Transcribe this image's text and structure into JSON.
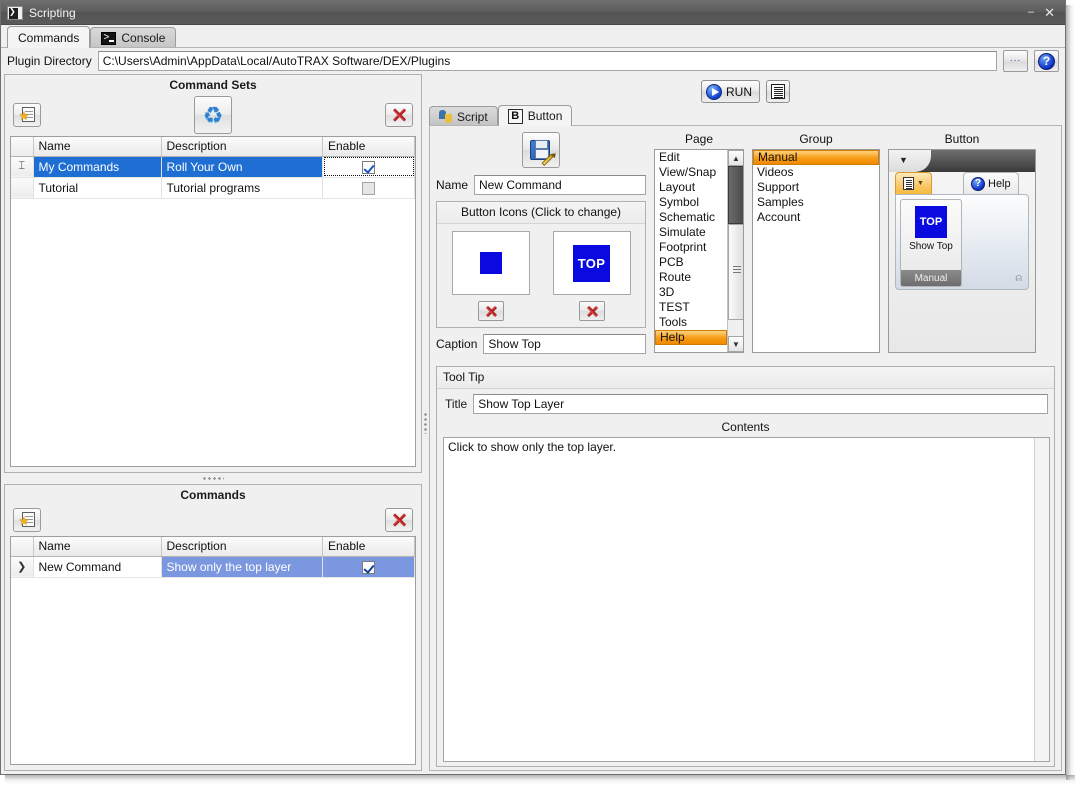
{
  "window": {
    "title": "Scripting",
    "icon": "console-icon",
    "minimize_label": "–",
    "close_label": "✕"
  },
  "top_tabs": [
    {
      "label": "Commands",
      "icon": "",
      "active": true
    },
    {
      "label": "Console",
      "icon": "console-icon",
      "active": false
    }
  ],
  "plugin_dir": {
    "label": "Plugin Directory",
    "value": "C:\\Users\\Admin\\AppData\\Local/AutoTRAX Software/DEX/Plugins",
    "browse_label": "...",
    "help_label": "?"
  },
  "command_sets": {
    "title": "Command Sets",
    "toolbar": {
      "new_label": "new-command-set",
      "refresh_label": "refresh",
      "delete_label": "delete"
    },
    "columns": [
      "",
      "Name",
      "Description",
      "Enable"
    ],
    "rows": [
      {
        "indicator": "⌶",
        "name": "My Commands",
        "description": "Roll Your Own",
        "enabled": true,
        "selected": true
      },
      {
        "indicator": "",
        "name": "Tutorial",
        "description": "Tutorial programs",
        "enabled": false,
        "selected": false
      }
    ]
  },
  "commands": {
    "title": "Commands",
    "toolbar": {
      "new_label": "new-command",
      "delete_label": "delete"
    },
    "columns": [
      "",
      "Name",
      "Description",
      "Enable"
    ],
    "rows": [
      {
        "indicator": "❯",
        "name": "New Command",
        "description": "Show only the top layer",
        "enabled": true,
        "selected": true
      }
    ]
  },
  "right": {
    "run_label": "RUN",
    "log_label": "log",
    "tabs": [
      {
        "label": "Script",
        "icon": "python-icon",
        "active": false
      },
      {
        "label": "Button",
        "icon": "bold-b-icon",
        "active": true
      }
    ],
    "save_label": "save",
    "name": {
      "label": "Name",
      "value": "New Command"
    },
    "button_icons": {
      "title": "Button Icons (Click to change)",
      "small_icon": "",
      "large_icon": "TOP",
      "delete_small_label": "delete-small-icon",
      "delete_large_label": "delete-large-icon"
    },
    "caption": {
      "label": "Caption",
      "value": "Show Top"
    },
    "page_list": {
      "caption": "Page",
      "items": [
        "Edit",
        "View/Snap",
        "Layout",
        "Symbol",
        "Schematic",
        "Simulate",
        "Footprint",
        "PCB",
        "Route",
        "3D",
        "TEST",
        "Tools",
        "Help"
      ],
      "selected": "Help"
    },
    "group_list": {
      "caption": "Group",
      "items": [
        "Manual",
        "Videos",
        "Support",
        "Samples",
        "Account"
      ],
      "selected": "Manual"
    },
    "button_preview": {
      "caption": "Button",
      "ribbon_tab_active": "",
      "ribbon_tab_other": "Help",
      "icon_text": "TOP",
      "button_caption": "Show Top",
      "group_name": "Manual"
    },
    "tooltip": {
      "group_title": "Tool Tip",
      "title_label": "Title",
      "title_value": "Show Top Layer",
      "contents_label": "Contents",
      "contents_value": "Click to show only the top layer."
    }
  },
  "colors": {
    "selection_blue": "#1f6ed4",
    "selection_light_blue": "#7a97e0",
    "selection_orange": "#f79c16",
    "icon_blue": "#0a0ae0",
    "window_bg": "#f0f0f0"
  }
}
